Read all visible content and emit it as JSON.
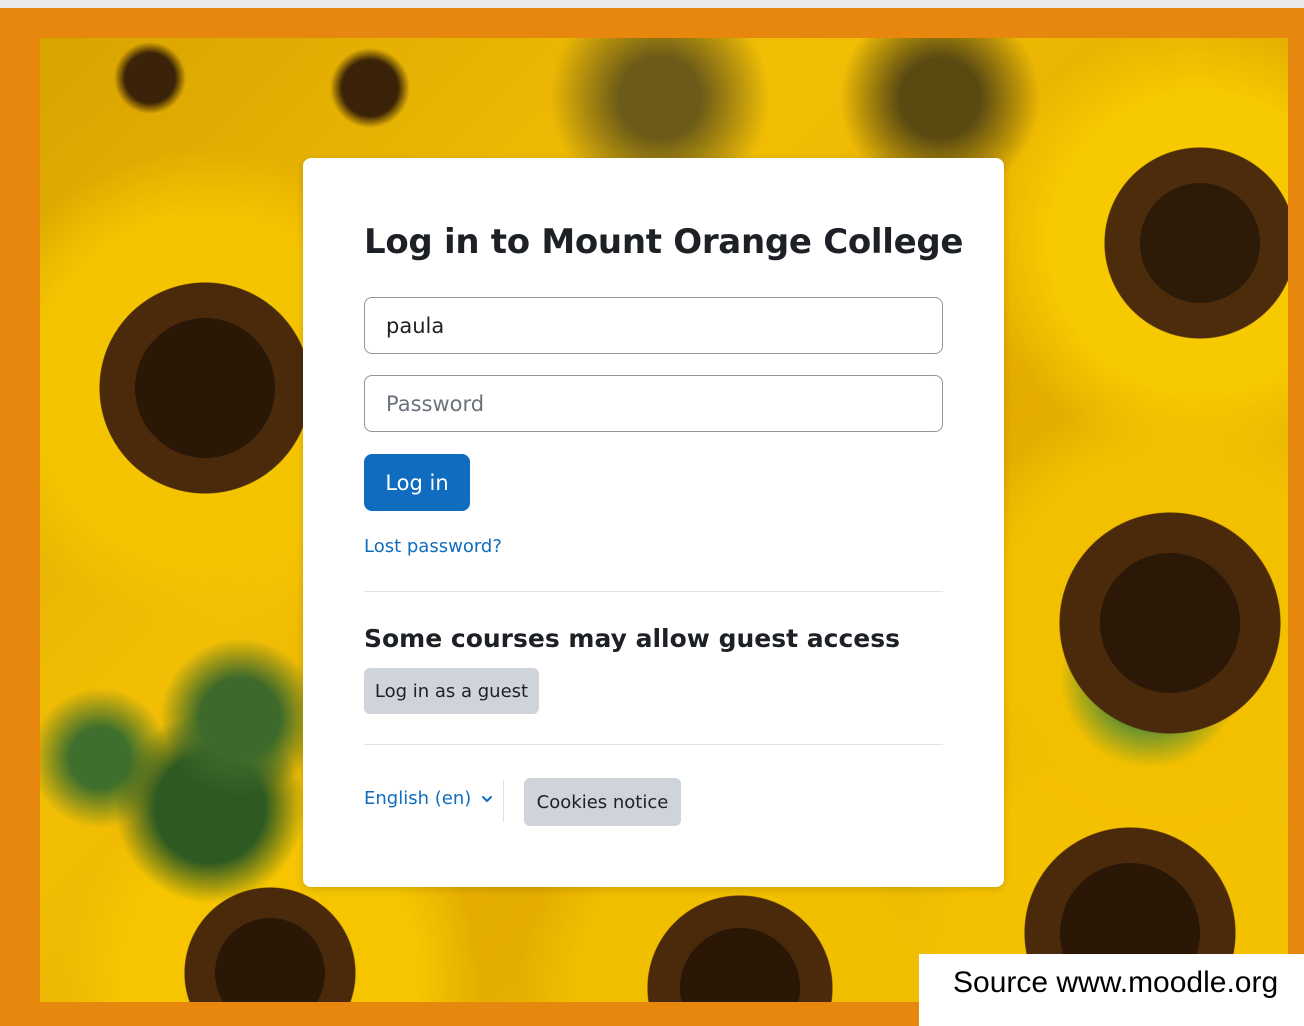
{
  "colors": {
    "frame": "#e8870e",
    "primary": "#0f6cbf",
    "secondary_button": "#ced4da",
    "text": "#1d2125"
  },
  "background": {
    "description_icon": "sunflower-photo"
  },
  "login": {
    "title": "Log in to Mount Orange College",
    "username_value": "paula",
    "password_placeholder": "Password",
    "login_button": "Log in",
    "lost_password": "Lost password?"
  },
  "guest": {
    "heading": "Some courses may allow guest access",
    "button": "Log in as a guest"
  },
  "footer": {
    "language": "English (en)",
    "language_icon": "chevron-down-icon",
    "cookies_button": "Cookies notice"
  },
  "caption": {
    "source": "Source www.moodle.org"
  }
}
